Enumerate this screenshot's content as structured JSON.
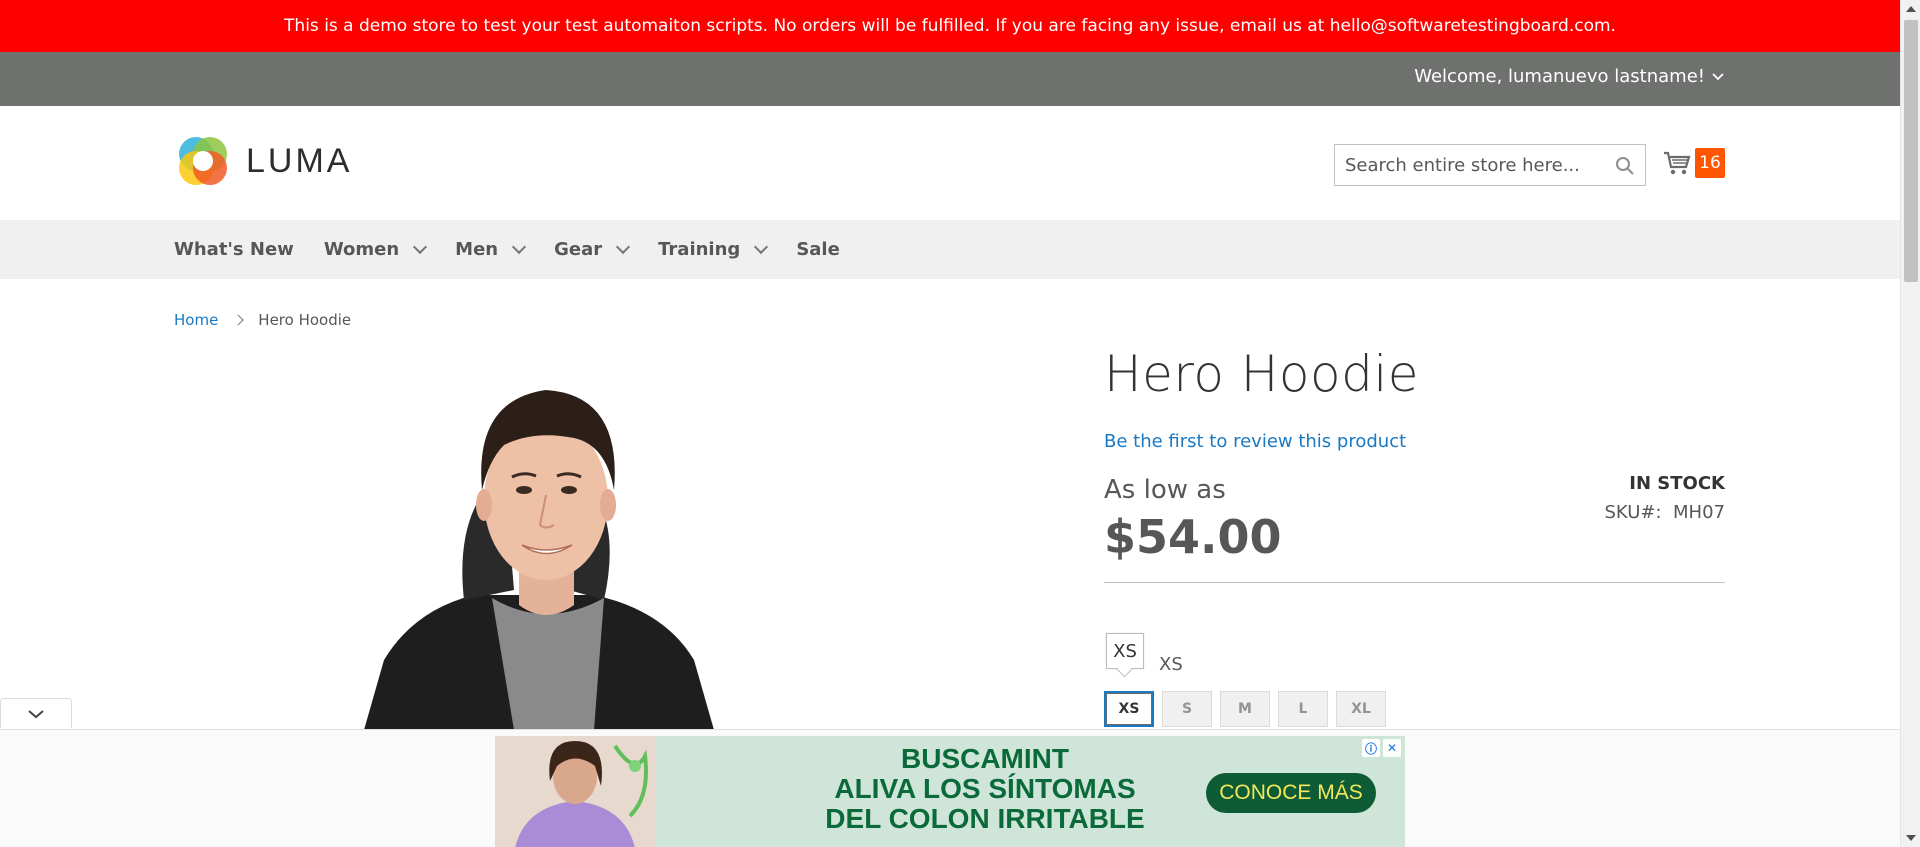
{
  "banner": {
    "text": "This is a demo store to test your test automaiton scripts. No orders will be fulfilled. If you are facing any issue, email us at hello@softwaretestingboard.com."
  },
  "welcome_bar": {
    "text": "Welcome, lumanuevo lastname!"
  },
  "header": {
    "logo_text": "LUMA",
    "search_placeholder": "Search entire store here...",
    "cart_count": "16"
  },
  "nav": {
    "items": [
      {
        "label": "What's New",
        "has_dropdown": false
      },
      {
        "label": "Women",
        "has_dropdown": true
      },
      {
        "label": "Men",
        "has_dropdown": true
      },
      {
        "label": "Gear",
        "has_dropdown": true
      },
      {
        "label": "Training",
        "has_dropdown": true
      },
      {
        "label": "Sale",
        "has_dropdown": false
      }
    ]
  },
  "breadcrumb": {
    "home": "Home",
    "current": "Hero Hoodie"
  },
  "product": {
    "title": "Hero Hoodie",
    "review_link": "Be the first to review this product",
    "stock": "IN STOCK",
    "sku_label": "SKU#:",
    "sku": "MH07",
    "as_low_as": "As low as",
    "price": "$54.00",
    "size_selected_label": "XS",
    "tooltip": "XS",
    "sizes": [
      "XS",
      "S",
      "M",
      "L",
      "XL"
    ]
  },
  "ad": {
    "line1": "BUSCAMINT",
    "line2": "ALIVA LOS SÍNTOMAS",
    "line3": "DEL COLON IRRITABLE",
    "cta": "CONOCE MÁS",
    "info_icon": "ⓘ",
    "close_icon": "✕"
  },
  "colors": {
    "banner": "#ff0000",
    "welcome_bar": "#6e716e",
    "link": "#1979c3",
    "cart_badge": "#ff5501",
    "ad_background": "#cfe5da",
    "ad_cta": "#0d5c35"
  }
}
